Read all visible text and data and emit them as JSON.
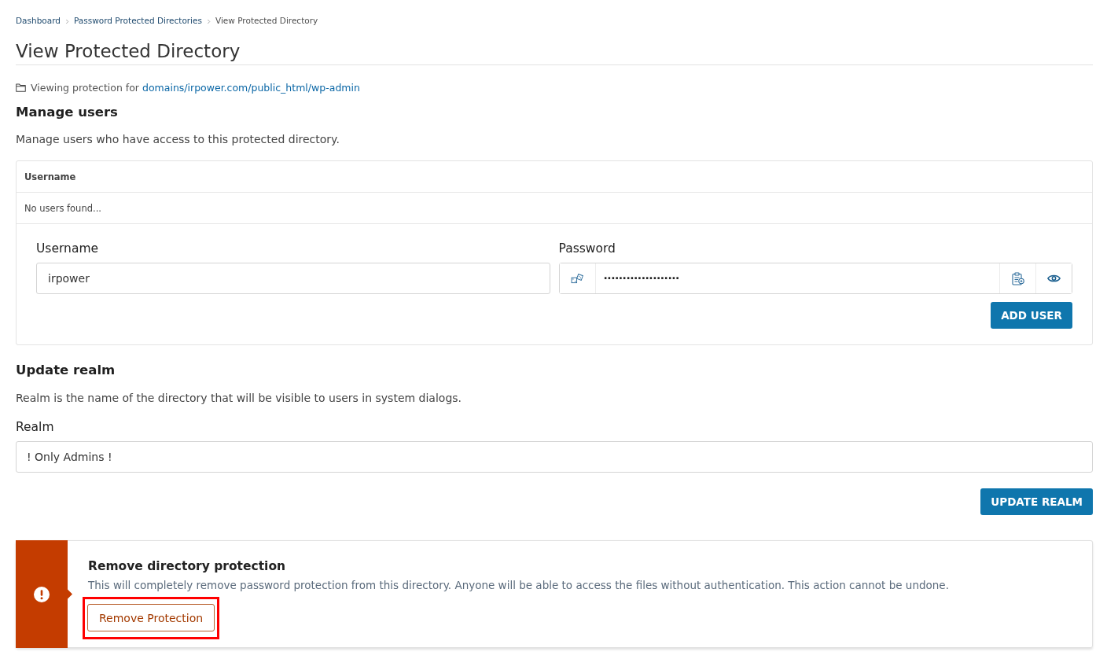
{
  "breadcrumb": [
    {
      "label": "Dashboard",
      "kind": "link"
    },
    {
      "label": "Password Protected Directories",
      "kind": "link"
    },
    {
      "label": "View Protected Directory",
      "kind": "current"
    }
  ],
  "page_title": "View Protected Directory",
  "location": {
    "prefix": "Viewing protection for",
    "path": "domains/irpower.com/public_html/wp-admin"
  },
  "manage_users": {
    "heading": "Manage users",
    "description": "Manage users who have access to this protected directory.",
    "table": {
      "columns": [
        "Username"
      ],
      "empty_message": "No users found..."
    },
    "form": {
      "username": {
        "label": "Username",
        "value": "irpower"
      },
      "password": {
        "label": "Password",
        "value": "····················"
      },
      "button": "ADD USER"
    }
  },
  "update_realm": {
    "heading": "Update realm",
    "description": "Realm is the name of the directory that will be visible to users in system dialogs.",
    "realm": {
      "label": "Realm",
      "value": "! Only Admins !"
    },
    "button": "UPDATE REALM"
  },
  "remove_protection": {
    "title": "Remove directory protection",
    "description": "This will completely remove password protection from this directory. Anyone will be able to access the files without authentication. This action cannot be undone.",
    "button": {
      "label": "Remove Protection",
      "highlighted": true
    }
  }
}
